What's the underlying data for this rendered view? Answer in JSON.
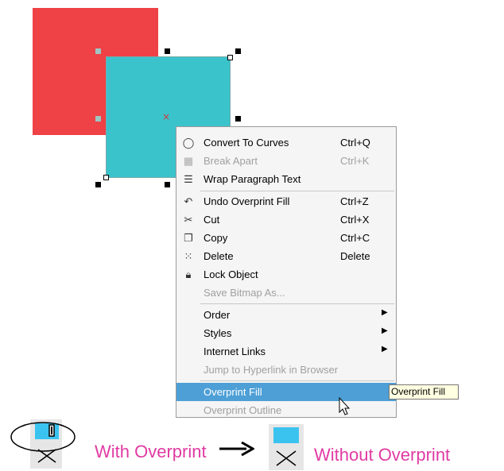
{
  "canvas": {
    "red_color": "#ee4246",
    "teal_color": "#3bc3cc"
  },
  "context_menu": {
    "items": [
      {
        "label": "Convert To Curves",
        "shortcut": "Ctrl+Q",
        "icon": "curves-icon",
        "disabled": false
      },
      {
        "label": "Break Apart",
        "shortcut": "Ctrl+K",
        "icon": "break-apart-icon",
        "disabled": true
      },
      {
        "label": "Wrap Paragraph Text",
        "shortcut": "",
        "icon": "wrap-text-icon",
        "disabled": false
      },
      {
        "label": "Undo Overprint Fill",
        "shortcut": "Ctrl+Z",
        "icon": "undo-icon",
        "disabled": false
      },
      {
        "label": "Cut",
        "shortcut": "Ctrl+X",
        "icon": "scissors-icon",
        "disabled": false
      },
      {
        "label": "Copy",
        "shortcut": "Ctrl+C",
        "icon": "copy-icon",
        "disabled": false
      },
      {
        "label": "Delete",
        "shortcut": "Delete",
        "icon": "delete-icon",
        "disabled": false
      },
      {
        "label": "Lock Object",
        "shortcut": "",
        "icon": "lock-icon",
        "disabled": false
      },
      {
        "label": "Save Bitmap As...",
        "shortcut": "",
        "icon": "",
        "disabled": true
      },
      {
        "label": "Order",
        "shortcut": "",
        "icon": "",
        "disabled": false,
        "submenu": true
      },
      {
        "label": "Styles",
        "shortcut": "",
        "icon": "",
        "disabled": false,
        "submenu": true
      },
      {
        "label": "Internet Links",
        "shortcut": "",
        "icon": "",
        "disabled": false,
        "submenu": true
      },
      {
        "label": "Jump to Hyperlink in Browser",
        "shortcut": "",
        "icon": "",
        "disabled": true
      },
      {
        "label": "Overprint Fill",
        "shortcut": "",
        "icon": "",
        "disabled": false,
        "highlighted": true
      },
      {
        "label": "Overprint Outline",
        "shortcut": "",
        "icon": "",
        "disabled": true
      }
    ]
  },
  "tooltip": "Overprint Fill",
  "legend": {
    "with_label": "With Overprint",
    "without_label": "Without Overprint",
    "accent_color": "#e03ba3",
    "swatch_color": "#3bc3f0"
  }
}
